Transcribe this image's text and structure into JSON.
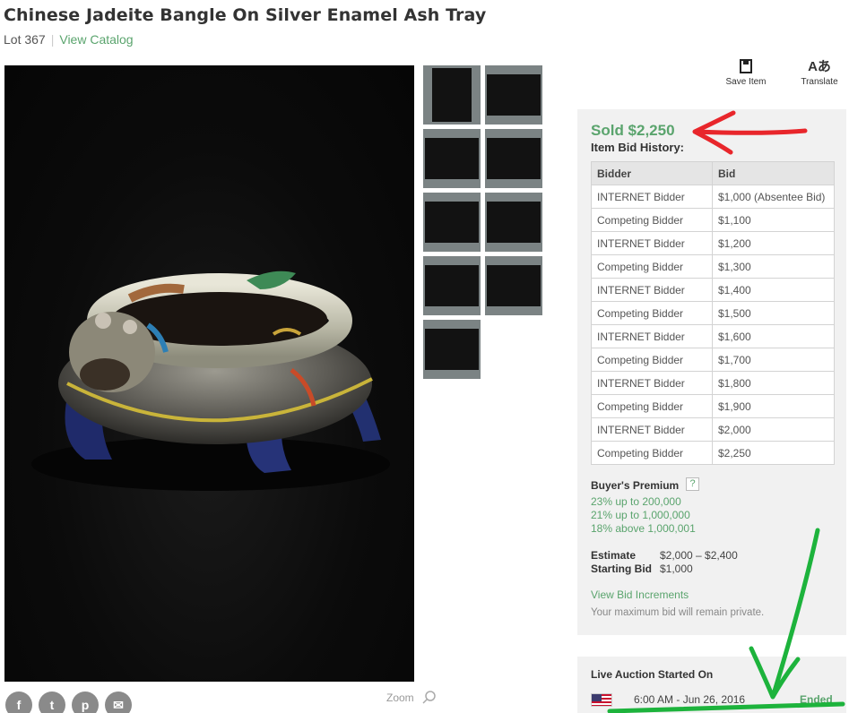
{
  "title": "Chinese Jadeite Bangle On Silver Enamel Ash Tray",
  "lot": {
    "label": "Lot 367",
    "separator": "|",
    "catalog_link": "View Catalog"
  },
  "toolbar": {
    "save_label": "Save Item",
    "translate_label": "Translate",
    "save_icon": "bookmark-icon",
    "translate_icon": "translate-icon"
  },
  "gallery": {
    "thumbnail_count": 9
  },
  "share": {
    "icons": [
      "facebook-icon",
      "twitter-icon",
      "pinterest-icon",
      "email-icon"
    ]
  },
  "zoom": {
    "label": "Zoom"
  },
  "bidding": {
    "sold_text": "Sold $2,250",
    "history_title": "Item Bid History:",
    "columns": [
      "Bidder",
      "Bid"
    ],
    "rows": [
      [
        "INTERNET Bidder",
        "$1,000 (Absentee Bid)"
      ],
      [
        "Competing Bidder",
        "$1,100"
      ],
      [
        "INTERNET Bidder",
        "$1,200"
      ],
      [
        "Competing Bidder",
        "$1,300"
      ],
      [
        "INTERNET Bidder",
        "$1,400"
      ],
      [
        "Competing Bidder",
        "$1,500"
      ],
      [
        "INTERNET Bidder",
        "$1,600"
      ],
      [
        "Competing Bidder",
        "$1,700"
      ],
      [
        "INTERNET Bidder",
        "$1,800"
      ],
      [
        "Competing Bidder",
        "$1,900"
      ],
      [
        "INTERNET Bidder",
        "$2,000"
      ],
      [
        "Competing Bidder",
        "$2,250"
      ]
    ],
    "buyers_premium_label": "Buyer's Premium",
    "buyers_premium_help": "?",
    "premium_tiers": [
      "23% up to 200,000",
      "21% up to 1,000,000",
      "18% above 1,000,001"
    ],
    "estimate_label": "Estimate",
    "estimate_value": "$2,000 – $2,400",
    "starting_bid_label": "Starting Bid",
    "starting_bid_value": "$1,000",
    "increments_link": "View Bid Increments",
    "private_note": "Your maximum bid will remain private."
  },
  "auction": {
    "live_label": "Live Auction Started On",
    "time": "6:00 AM - Jun 26, 2016",
    "status": "Ended"
  },
  "colors": {
    "accent_green": "#5aa46d",
    "panel_bg": "#f1f1f1",
    "annotation_red": "#e8262b",
    "annotation_green": "#1db33c"
  }
}
